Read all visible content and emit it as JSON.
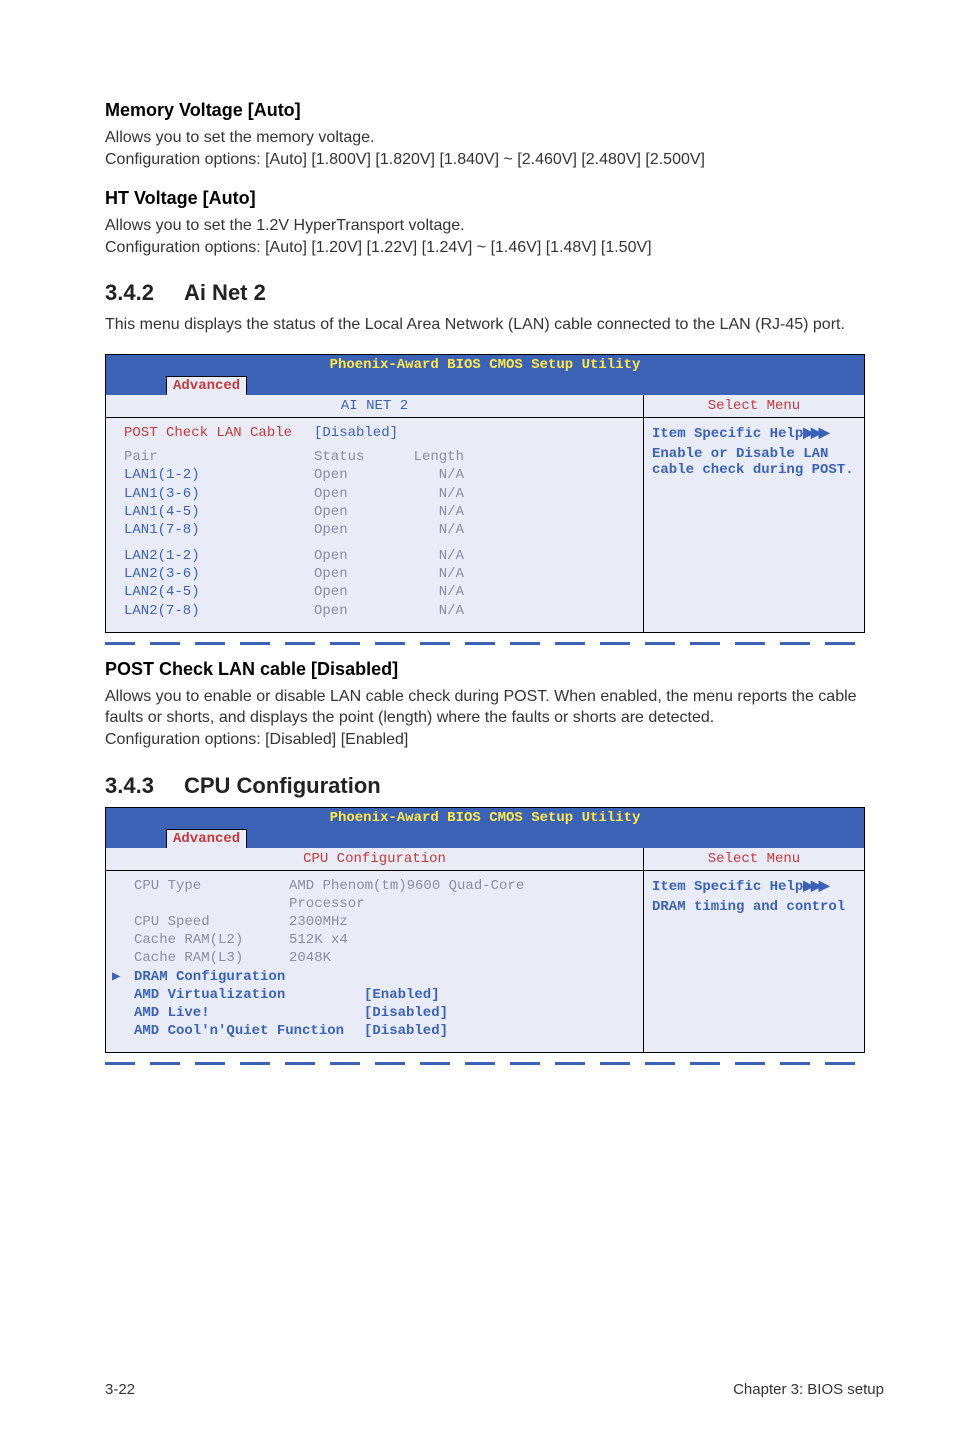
{
  "section1": {
    "heading": "Memory Voltage [Auto]",
    "body": "Allows you to set the memory voltage.\nConfiguration options: [Auto] [1.800V] [1.820V] [1.840V] ~ [2.460V] [2.480V] [2.500V]"
  },
  "section2": {
    "heading": "HT Voltage [Auto]",
    "body": "Allows you to set the 1.2V HyperTransport voltage.\nConfiguration options: [Auto] [1.20V] [1.22V] [1.24V] ~ [1.46V] [1.48V] [1.50V]"
  },
  "section342": {
    "num": "3.4.2",
    "title": "Ai Net 2",
    "intro": "This menu displays the status of the Local Area Network (LAN) cable connected to the LAN (RJ-45) port."
  },
  "bios1": {
    "title": "Phoenix-Award BIOS CMOS Setup Utility",
    "tab": "Advanced",
    "panelLeft": "AI NET 2",
    "panelRight": "Select Menu",
    "helpLabel": "Item Specific Help",
    "helpText": "Enable or Disable LAN cable check during POST.",
    "postRowLabel": "POST Check LAN Cable",
    "postRowValue": "[Disabled]",
    "headerPair": "Pair",
    "headerStatus": "Status",
    "headerLength": "Length",
    "rows1": [
      {
        "pair": "LAN1(1-2)",
        "status": "Open",
        "length": "N/A"
      },
      {
        "pair": "LAN1(3-6)",
        "status": "Open",
        "length": "N/A"
      },
      {
        "pair": "LAN1(4-5)",
        "status": "Open",
        "length": "N/A"
      },
      {
        "pair": "LAN1(7-8)",
        "status": "Open",
        "length": "N/A"
      }
    ],
    "rows2": [
      {
        "pair": "LAN2(1-2)",
        "status": "Open",
        "length": "N/A"
      },
      {
        "pair": "LAN2(3-6)",
        "status": "Open",
        "length": "N/A"
      },
      {
        "pair": "LAN2(4-5)",
        "status": "Open",
        "length": "N/A"
      },
      {
        "pair": "LAN2(7-8)",
        "status": "Open",
        "length": "N/A"
      }
    ]
  },
  "postcheck": {
    "heading": "POST Check LAN cable [Disabled]",
    "body": "Allows you to enable or disable LAN cable check during POST. When enabled, the menu reports the cable faults or shorts, and displays the point (length) where the faults or shorts are detected.\nConfiguration options: [Disabled] [Enabled]"
  },
  "section343": {
    "num": "3.4.3",
    "title": "CPU Configuration"
  },
  "bios2": {
    "title": "Phoenix-Award BIOS CMOS Setup Utility",
    "tab": "Advanced",
    "panelLeft": "CPU Configuration",
    "panelRight": "Select Menu",
    "helpLabel": "Item Specific Help",
    "helpText": "DRAM timing and control",
    "rows": [
      {
        "label": "CPU Type",
        "value": "AMD Phenom(tm)9600 Quad-Core"
      },
      {
        "label": "",
        "value": "Processor"
      },
      {
        "label": "CPU Speed",
        "value": "2300MHz"
      },
      {
        "label": "Cache RAM(L2)",
        "value": " 512K x4"
      },
      {
        "label": "Cache RAM(L3)",
        "value": "2048K"
      }
    ],
    "boldRows": [
      {
        "label": "DRAM Configuration",
        "value": ""
      },
      {
        "label": "AMD Virtualization",
        "value": "[Enabled]"
      },
      {
        "label": "AMD Live!",
        "value": "[Disabled]"
      },
      {
        "label": "AMD Cool'n'Quiet Function",
        "value": "[Disabled]"
      }
    ]
  },
  "footer": {
    "page": "3-22",
    "chapter": "Chapter 3: BIOS setup"
  }
}
